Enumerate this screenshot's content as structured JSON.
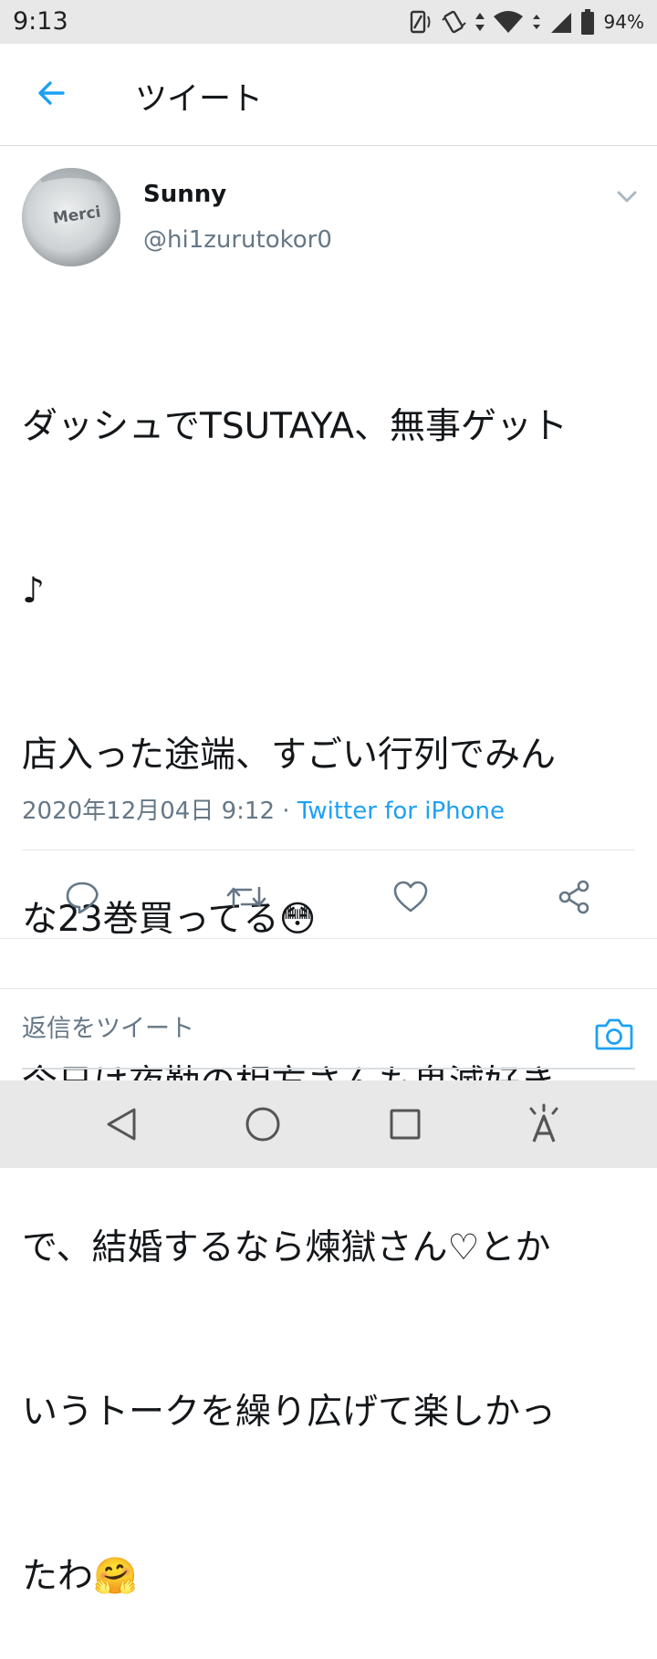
{
  "status_bar": {
    "time": "9:13",
    "battery": "94%"
  },
  "header": {
    "title": "ツイート",
    "back_icon": "arrow-left-icon"
  },
  "tweet": {
    "author_name": "Sunny",
    "author_handle": "@hi1zurutokor0",
    "avatar_text": "Merci",
    "text_lines": [
      "ダッシュでTSUTAYA、無事ゲット",
      "♪",
      "店入った途端、すごい行列でみん",
      "な23巻買ってる😳",
      "今日は夜勤の相方さんも鬼滅好き",
      "で、結婚するなら煉獄さん♡とか",
      "いうトークを繰り広げて楽しかっ",
      "たわ🤗"
    ],
    "date": "2020年12月04日 9:12",
    "separator": "·",
    "source": "Twitter for iPhone"
  },
  "actions": {
    "reply_icon": "comment-icon",
    "retweet_icon": "retweet-icon",
    "like_icon": "heart-icon",
    "share_icon": "share-icon"
  },
  "reply_bar": {
    "placeholder": "返信をツイート"
  },
  "colors": {
    "accent": "#1da1f2",
    "secondary_text": "#657786",
    "primary_text": "#14171a"
  }
}
